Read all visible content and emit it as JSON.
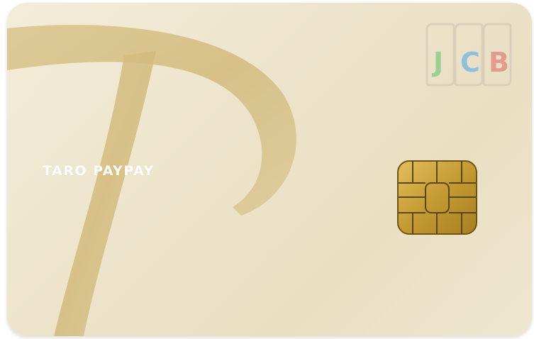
{
  "card": {
    "cardholder_name": "TARO PAYPAY",
    "brand_logo_text": "JCB",
    "brand_letters": [
      "J",
      "C",
      "B"
    ],
    "colors": {
      "card_base": "#eee6d0",
      "logo_mark": "#d8c48c",
      "chip_gold": "#c9a03a",
      "brand_j": "#9ccf93",
      "brand_c": "#8fbfdc",
      "brand_b": "#e39a8f"
    }
  },
  "icons": [
    "paypay-p-logo-icon",
    "emv-chip-icon",
    "jcb-logo-icon"
  ]
}
